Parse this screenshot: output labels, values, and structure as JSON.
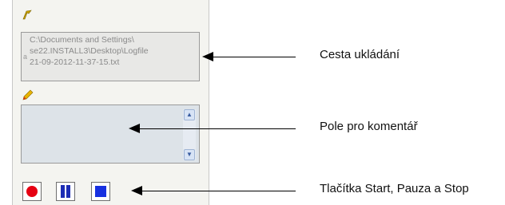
{
  "panel": {
    "path_field": {
      "lines": [
        "C:\\Documents and Settings\\",
        "se22.INSTALL3\\Desktop\\Logfile",
        "21-09-2012-11-37-15.txt"
      ],
      "caret": "a"
    },
    "comment_field": {
      "value": ""
    },
    "buttons": {
      "start": "start-button",
      "pause": "pause-button",
      "stop": "stop-button"
    }
  },
  "annotations": {
    "save_path": "Cesta ukládání",
    "comment": "Pole pro komentář",
    "buttons": "Tlačítka Start, Pauza a Stop"
  },
  "icons": {
    "path_icon": "folder-pen-icon",
    "comment_icon": "pencil-icon",
    "scroll_up": "chevron-up-icon",
    "scroll_down": "chevron-down-icon"
  },
  "colors": {
    "start": "#e60012",
    "pause": "#1d2db5",
    "stop": "#1730e0"
  }
}
